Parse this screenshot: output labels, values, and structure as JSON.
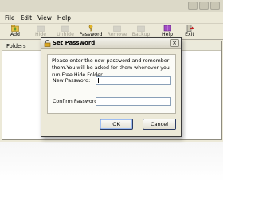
{
  "menu": [
    "File",
    "Edit",
    "View",
    "Help"
  ],
  "toolbar": {
    "add": "Add",
    "hide": "Hide",
    "unhide": "Unhide",
    "password": "Password",
    "remove": "Remove",
    "backup": "Backup",
    "help": "Help",
    "exit": "Exit"
  },
  "folders_header": "Folders",
  "dialog": {
    "title": "Set Password",
    "close": "×",
    "message": "Please enter the new password and remember them.You will be asked for them whenever you run Free Hide Folder.",
    "new_password_label": "New Password:",
    "new_password_value": "",
    "confirm_password_label": "Confirm Password:",
    "confirm_password_value": "",
    "ok_mnemonic": "O",
    "ok_rest": "K",
    "cancel_mnemonic": "C",
    "cancel_rest": "ancel"
  },
  "colors": {
    "window_bg": "#ece9d8",
    "button_border": "#2b3b63",
    "input_border": "#8aa0b8"
  }
}
